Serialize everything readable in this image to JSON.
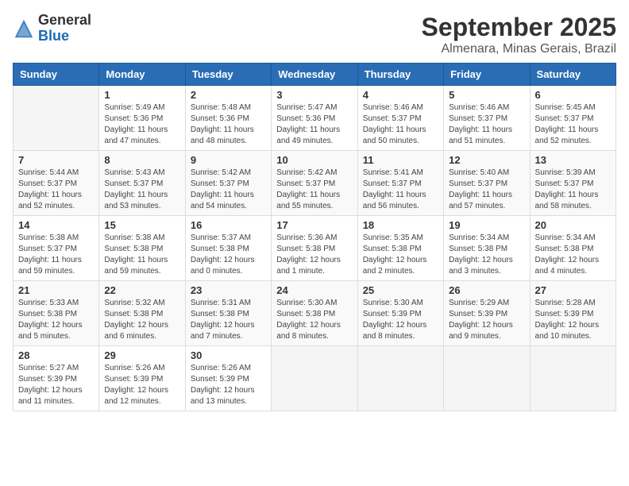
{
  "logo": {
    "general": "General",
    "blue": "Blue"
  },
  "title": "September 2025",
  "subtitle": "Almenara, Minas Gerais, Brazil",
  "weekdays": [
    "Sunday",
    "Monday",
    "Tuesday",
    "Wednesday",
    "Thursday",
    "Friday",
    "Saturday"
  ],
  "weeks": [
    [
      {
        "day": "",
        "info": ""
      },
      {
        "day": "1",
        "info": "Sunrise: 5:49 AM\nSunset: 5:36 PM\nDaylight: 11 hours\nand 47 minutes."
      },
      {
        "day": "2",
        "info": "Sunrise: 5:48 AM\nSunset: 5:36 PM\nDaylight: 11 hours\nand 48 minutes."
      },
      {
        "day": "3",
        "info": "Sunrise: 5:47 AM\nSunset: 5:36 PM\nDaylight: 11 hours\nand 49 minutes."
      },
      {
        "day": "4",
        "info": "Sunrise: 5:46 AM\nSunset: 5:37 PM\nDaylight: 11 hours\nand 50 minutes."
      },
      {
        "day": "5",
        "info": "Sunrise: 5:46 AM\nSunset: 5:37 PM\nDaylight: 11 hours\nand 51 minutes."
      },
      {
        "day": "6",
        "info": "Sunrise: 5:45 AM\nSunset: 5:37 PM\nDaylight: 11 hours\nand 52 minutes."
      }
    ],
    [
      {
        "day": "7",
        "info": "Sunrise: 5:44 AM\nSunset: 5:37 PM\nDaylight: 11 hours\nand 52 minutes."
      },
      {
        "day": "8",
        "info": "Sunrise: 5:43 AM\nSunset: 5:37 PM\nDaylight: 11 hours\nand 53 minutes."
      },
      {
        "day": "9",
        "info": "Sunrise: 5:42 AM\nSunset: 5:37 PM\nDaylight: 11 hours\nand 54 minutes."
      },
      {
        "day": "10",
        "info": "Sunrise: 5:42 AM\nSunset: 5:37 PM\nDaylight: 11 hours\nand 55 minutes."
      },
      {
        "day": "11",
        "info": "Sunrise: 5:41 AM\nSunset: 5:37 PM\nDaylight: 11 hours\nand 56 minutes."
      },
      {
        "day": "12",
        "info": "Sunrise: 5:40 AM\nSunset: 5:37 PM\nDaylight: 11 hours\nand 57 minutes."
      },
      {
        "day": "13",
        "info": "Sunrise: 5:39 AM\nSunset: 5:37 PM\nDaylight: 11 hours\nand 58 minutes."
      }
    ],
    [
      {
        "day": "14",
        "info": "Sunrise: 5:38 AM\nSunset: 5:37 PM\nDaylight: 11 hours\nand 59 minutes."
      },
      {
        "day": "15",
        "info": "Sunrise: 5:38 AM\nSunset: 5:38 PM\nDaylight: 11 hours\nand 59 minutes."
      },
      {
        "day": "16",
        "info": "Sunrise: 5:37 AM\nSunset: 5:38 PM\nDaylight: 12 hours\nand 0 minutes."
      },
      {
        "day": "17",
        "info": "Sunrise: 5:36 AM\nSunset: 5:38 PM\nDaylight: 12 hours\nand 1 minute."
      },
      {
        "day": "18",
        "info": "Sunrise: 5:35 AM\nSunset: 5:38 PM\nDaylight: 12 hours\nand 2 minutes."
      },
      {
        "day": "19",
        "info": "Sunrise: 5:34 AM\nSunset: 5:38 PM\nDaylight: 12 hours\nand 3 minutes."
      },
      {
        "day": "20",
        "info": "Sunrise: 5:34 AM\nSunset: 5:38 PM\nDaylight: 12 hours\nand 4 minutes."
      }
    ],
    [
      {
        "day": "21",
        "info": "Sunrise: 5:33 AM\nSunset: 5:38 PM\nDaylight: 12 hours\nand 5 minutes."
      },
      {
        "day": "22",
        "info": "Sunrise: 5:32 AM\nSunset: 5:38 PM\nDaylight: 12 hours\nand 6 minutes."
      },
      {
        "day": "23",
        "info": "Sunrise: 5:31 AM\nSunset: 5:38 PM\nDaylight: 12 hours\nand 7 minutes."
      },
      {
        "day": "24",
        "info": "Sunrise: 5:30 AM\nSunset: 5:38 PM\nDaylight: 12 hours\nand 8 minutes."
      },
      {
        "day": "25",
        "info": "Sunrise: 5:30 AM\nSunset: 5:39 PM\nDaylight: 12 hours\nand 8 minutes."
      },
      {
        "day": "26",
        "info": "Sunrise: 5:29 AM\nSunset: 5:39 PM\nDaylight: 12 hours\nand 9 minutes."
      },
      {
        "day": "27",
        "info": "Sunrise: 5:28 AM\nSunset: 5:39 PM\nDaylight: 12 hours\nand 10 minutes."
      }
    ],
    [
      {
        "day": "28",
        "info": "Sunrise: 5:27 AM\nSunset: 5:39 PM\nDaylight: 12 hours\nand 11 minutes."
      },
      {
        "day": "29",
        "info": "Sunrise: 5:26 AM\nSunset: 5:39 PM\nDaylight: 12 hours\nand 12 minutes."
      },
      {
        "day": "30",
        "info": "Sunrise: 5:26 AM\nSunset: 5:39 PM\nDaylight: 12 hours\nand 13 minutes."
      },
      {
        "day": "",
        "info": ""
      },
      {
        "day": "",
        "info": ""
      },
      {
        "day": "",
        "info": ""
      },
      {
        "day": "",
        "info": ""
      }
    ]
  ]
}
